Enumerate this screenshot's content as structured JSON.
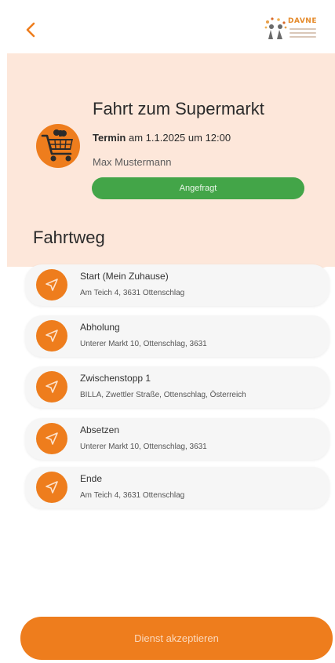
{
  "header": {
    "back_icon": "chevron-left-icon",
    "logo_text": "DAVNE",
    "accent_color": "#ee7d1d"
  },
  "trip": {
    "title": "Fahrt zum Supermarkt",
    "appointment_label": "Termin",
    "appointment_text": "am 1.1.2025 um 12:00",
    "person": "Max Mustermann",
    "status": "Angefragt",
    "status_color": "#43a548",
    "avatar_icon": "shopping-cart-icon"
  },
  "route": {
    "title": "Fahrtweg",
    "stop_icon": "navigation-arrow-icon",
    "stops": [
      {
        "label": "Start (Mein Zuhause)",
        "address": "Am Teich 4, 3631 Ottenschlag"
      },
      {
        "label": "Abholung",
        "address": "Unterer Markt 10, Ottenschlag, 3631"
      },
      {
        "label": "Zwischenstopp 1",
        "address": "BILLA, Zwettler Straße, Ottenschlag, Österreich"
      },
      {
        "label": "Absetzen",
        "address": "Unterer Markt 10, Ottenschlag, 3631"
      },
      {
        "label": "Ende",
        "address": "Am Teich 4, 3631 Ottenschlag"
      }
    ]
  },
  "footer": {
    "accept_label": "Dienst akzeptieren"
  }
}
